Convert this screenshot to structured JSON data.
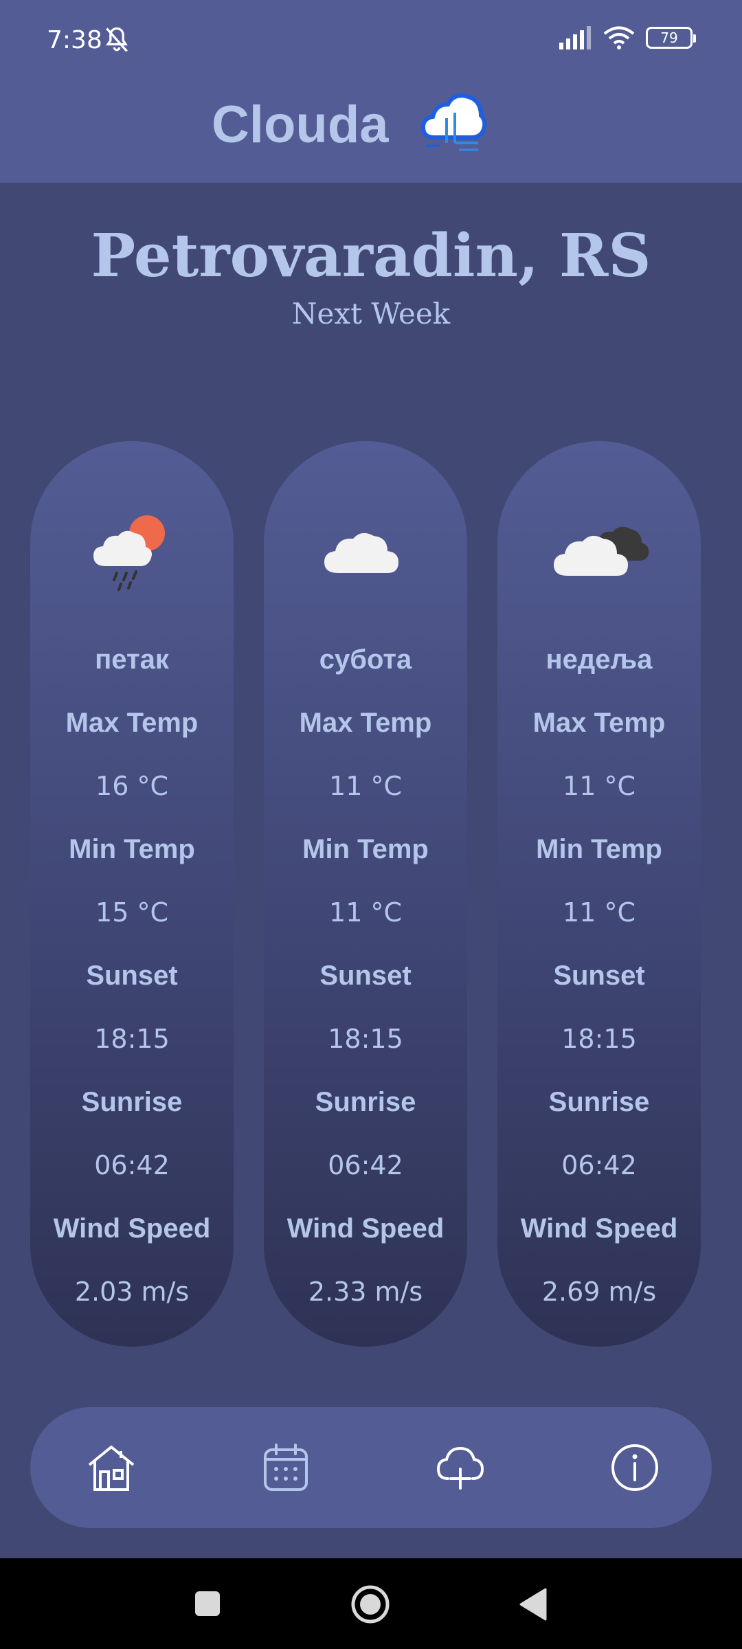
{
  "status": {
    "time": "7:38",
    "battery": "79"
  },
  "header": {
    "title": "Clouda"
  },
  "location": {
    "city": "Petrovaradin, RS",
    "period": "Next Week"
  },
  "days": [
    {
      "day": "петак",
      "icon": "sun-cloud-rain-icon",
      "max_label": "Max Temp",
      "max": "16 °C",
      "min_label": "Min Temp",
      "min": "15 °C",
      "sunset_label": "Sunset",
      "sunset": "18:15",
      "sunrise_label": "Sunrise",
      "sunrise": "06:42",
      "wind_label": "Wind Speed",
      "wind": "2.03 m/s"
    },
    {
      "day": "субота",
      "icon": "cloud-icon",
      "max_label": "Max Temp",
      "max": "11 °C",
      "min_label": "Min Temp",
      "min": "11 °C",
      "sunset_label": "Sunset",
      "sunset": "18:15",
      "sunrise_label": "Sunrise",
      "sunrise": "06:42",
      "wind_label": "Wind Speed",
      "wind": "2.33 m/s"
    },
    {
      "day": "недеља",
      "icon": "dark-clouds-icon",
      "max_label": "Max Temp",
      "max": "11 °C",
      "min_label": "Min Temp",
      "min": "11 °C",
      "sunset_label": "Sunset",
      "sunset": "18:15",
      "sunrise_label": "Sunrise",
      "sunrise": "06:42",
      "wind_label": "Wind Speed",
      "wind": "2.69 m/s"
    }
  ],
  "nav": [
    "home-icon",
    "calendar-icon",
    "cloud-add-icon",
    "info-icon"
  ],
  "colors": {
    "background": "#414873",
    "header": "#535c94",
    "text": "#b4c6ea",
    "accent_sun": "#ee6a4a"
  }
}
